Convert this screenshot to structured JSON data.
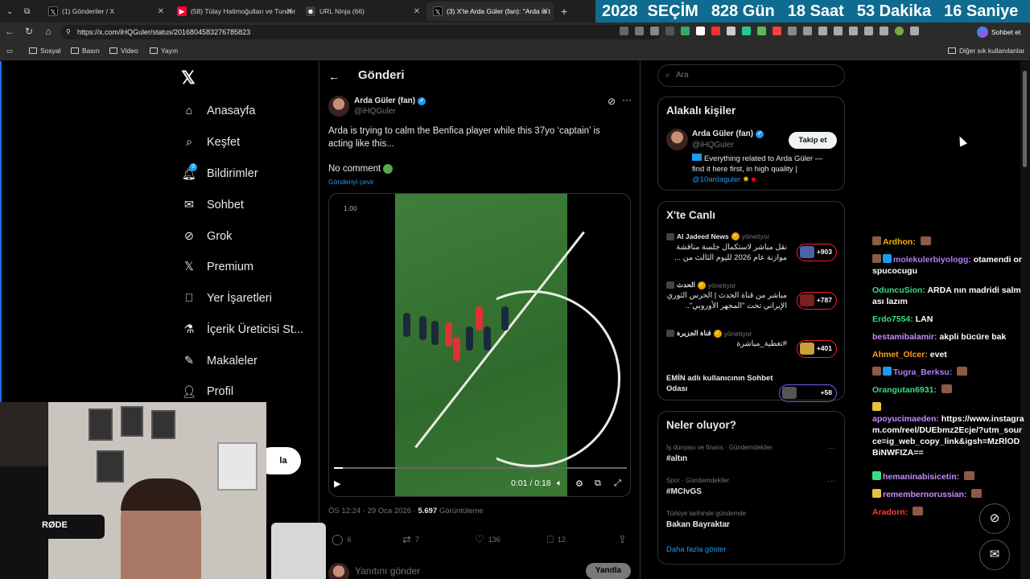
{
  "browser": {
    "tabs": [
      {
        "title": "(1) Gönderiler / X"
      },
      {
        "title": "(58) Tülay Hatimoğulları ve Tuncer"
      },
      {
        "title": "URL Ninja (66)"
      },
      {
        "title": "(3) X'te Arda Güler (fan): \"Arda is t"
      }
    ],
    "new_tab": "+",
    "url": "https://x.com/iHQGuler/status/2016804583276785823",
    "profile_label": "Sohbet et",
    "bookmarks": [
      "Sosyal",
      "Basın",
      "Video",
      "Yayın"
    ],
    "other_bookmarks": "Diğer sık kullanılanlar"
  },
  "countdown": [
    "2028",
    "SEÇİM",
    "828 Gün",
    "18 Saat",
    "53 Dakika",
    "16 Saniye"
  ],
  "nav": {
    "items": [
      {
        "label": "Anasayfa",
        "icon": "home-icon"
      },
      {
        "label": "Keşfet",
        "icon": "search-icon"
      },
      {
        "label": "Bildirimler",
        "icon": "bell-icon",
        "badge": "3"
      },
      {
        "label": "Sohbet",
        "icon": "mail-icon"
      },
      {
        "label": "Grok",
        "icon": "grok-icon"
      },
      {
        "label": "Premium",
        "icon": "x-icon"
      },
      {
        "label": "Yer İşaretleri",
        "icon": "bookmark-icon"
      },
      {
        "label": "İçerik Üreticisi St...",
        "icon": "creator-icon"
      },
      {
        "label": "Makaleler",
        "icon": "article-icon"
      },
      {
        "label": "Profil",
        "icon": "profile-icon"
      }
    ],
    "post_button_partial": "la"
  },
  "post": {
    "header_title": "Gönderi",
    "author_name": "Arda Güler (fan)",
    "author_handle": "@iHQGuler",
    "text": "Arda is trying to calm the Benfica player while this 37yo ‘captain’ is acting like this...",
    "text2": "No comment",
    "translate": "Gönderiyi çevir",
    "video": {
      "speed": "1.00",
      "time": "0:01 / 0:18",
      "progress": 0.03
    },
    "meta_time": "ÖS 12:24 · 29 Oca 2026 · ",
    "views_count": "5.697",
    "views_label": " Görüntüleme",
    "replies": "6",
    "reposts": "7",
    "likes": "136",
    "bookmarks": "12",
    "reply_placeholder": "Yanıtını gönder",
    "reply_button": "Yanıtla"
  },
  "sidebar": {
    "search_placeholder": "Ara",
    "related": {
      "title": "Alakalı kişiler",
      "name": "Arda Güler (fan)",
      "handle": "@iHQGuler",
      "follow": "Takip et",
      "bio": "Everything related to Arda Güler — find it here first, in high quality |",
      "bio_link": "@10ardaguler"
    },
    "live": {
      "title": "X'te Canlı",
      "items": [
        {
          "source": "Al Jadeed News",
          "status": "yönetiyor",
          "text": "نقل مباشر لاستكمال جلسة مناقشة موازنة عام 2026 لليوم الثالث من ...",
          "count": "+903"
        },
        {
          "source": "الحدث",
          "status": "yönetiyor",
          "text": "مباشر من قناة الحدث | الحرس الثوري الإيراني تحت \"المجهر الأوروبي\"..",
          "count": "+787"
        },
        {
          "source": "قناة الجزيرة",
          "status": "yönetiyor",
          "text": "#تغطية_مباشرة",
          "count": "+401"
        },
        {
          "source": "",
          "status": "",
          "text": "EMİN adlı kullanıcının Sohbet Odası",
          "count": "+58"
        }
      ]
    },
    "trends": {
      "title": "Neler oluyor?",
      "items": [
        {
          "category": "İş dünyası ve finans · Gündemdekiler",
          "title": "#altın"
        },
        {
          "category": "Spor · Gündemdekiler",
          "title": "#MCIvGS"
        },
        {
          "category": "Türkiye tarihinde gündemde",
          "title": "Bakan Bayraktar"
        }
      ],
      "show_more": "Daha fazla göster"
    }
  },
  "chat": [
    {
      "user": "Ardhon:",
      "msg": "",
      "color": "#ffb000"
    },
    {
      "user": "molekulerbiyologg:",
      "msg": "otamendi orspucocugu",
      "color": "#b07cff"
    },
    {
      "user": "OdunсuSion:",
      "msg": "ARDA nın madridi salması lazım",
      "color": "#3ddc84"
    },
    {
      "user": "Erdo7554:",
      "msg": "LAN",
      "color": "#3ddc84"
    },
    {
      "user": "bestamibalamir:",
      "msg": "akpli bücüre bak",
      "color": "#c58cff"
    },
    {
      "user": "Ahmet_Olcer:",
      "msg": "evet",
      "color": "#ff9f1c"
    },
    {
      "user": "Tugra_Berksu:",
      "msg": "",
      "color": "#b07cff"
    },
    {
      "user": "Orangutan6931:",
      "msg": "",
      "color": "#3ddc84"
    },
    {
      "user": "apoyucimaeden:",
      "msg": "https://www.instagram.com/reel/DUEbmz2Ecje/?utm_source=ig_web_copy_link&igsh=MzRlODBiNWFIZA==",
      "color": "#c58cff"
    },
    {
      "user": "hemaninabisicetin:",
      "msg": "",
      "color": "#c58cff"
    },
    {
      "user": "remembernorussian:",
      "msg": "",
      "color": "#c58cff"
    },
    {
      "user": "Aradorn:",
      "msg": "",
      "color": "#ff3b3b"
    }
  ]
}
